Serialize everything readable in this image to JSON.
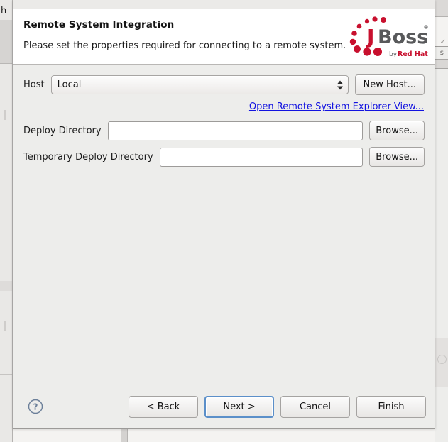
{
  "background": {
    "left_letter": "h",
    "right_letter": "s"
  },
  "dialog": {
    "header": {
      "title": "Remote System Integration",
      "subtitle": "Please set the properties required for connecting to a remote system.",
      "logo": {
        "name": "jboss-logo",
        "word_j": "J",
        "word_boss": "Boss",
        "registered": "®",
        "by_text": "by",
        "brand_text": "Red Hat",
        "dot_color": "#c8102e",
        "j_color": "#c8102e",
        "boss_color": "#58595b",
        "redhat_color": "#c8102e",
        "by_color": "#58595b"
      }
    },
    "form": {
      "host_label": "Host",
      "host_value": "Local",
      "host_placeholder": "",
      "new_host_button": "New Host...",
      "open_rse_link": "Open Remote System Explorer View...",
      "link_color": "#1313e0",
      "deploy_label": "Deploy Directory",
      "deploy_value": "",
      "deploy_placeholder": "",
      "deploy_browse_button": "Browse...",
      "temp_label": "Temporary Deploy Directory",
      "temp_value": "",
      "temp_placeholder": "",
      "temp_browse_button": "Browse..."
    },
    "footer": {
      "help_icon_name": "help-question-icon",
      "help_glyph": "?",
      "back_button": "< Back",
      "next_button": "Next >",
      "cancel_button": "Cancel",
      "finish_button": "Finish",
      "focused_button": "Next >",
      "focus_color": "#5b8fc9"
    }
  }
}
